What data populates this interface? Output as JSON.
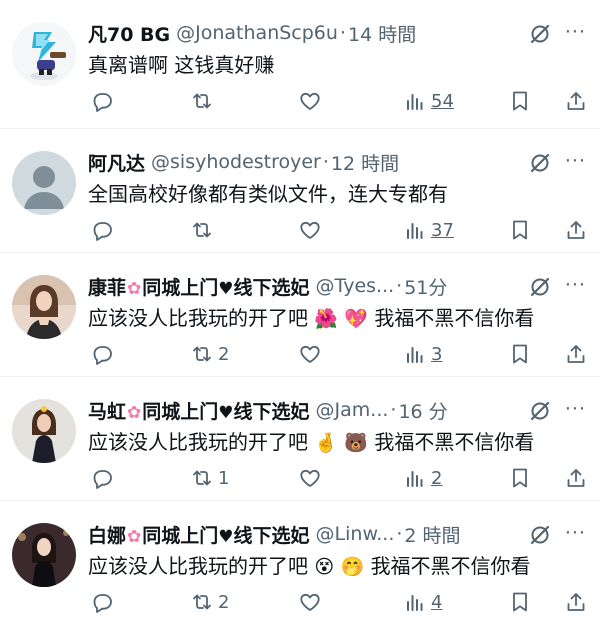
{
  "tweets": [
    {
      "name": "凡70 BG",
      "handle": "@JonathanScp6u",
      "time": "14 時間",
      "text": "真离谱啊 这钱真好赚",
      "emoji": [],
      "text_tail": "",
      "replies": "",
      "retweets": "",
      "likes": "",
      "views": "54",
      "avatar": "cartoon-character"
    },
    {
      "name": "阿凡达",
      "handle": "@sisyhodestroyer",
      "time": "12 時間",
      "text": "全国高校好像都有类似文件，连大专都有",
      "emoji": [],
      "text_tail": "",
      "replies": "",
      "retweets": "",
      "likes": "",
      "views": "37",
      "avatar": "default-profile"
    },
    {
      "name_a": "康菲",
      "name_b": "同城上门",
      "name_c": "线下选妃",
      "handle": "@Tyes...",
      "time": "51分",
      "text": "应该没人比我玩的开了吧",
      "emoji": [
        "🌺",
        "💖"
      ],
      "text_tail": "我福不黑不信你看",
      "replies": "",
      "retweets": "2",
      "likes": "",
      "views": "3",
      "avatar": "woman-photo"
    },
    {
      "name_a": "马虹",
      "name_b": "同城上门",
      "name_c": "线下选妃",
      "handle": "@Jam...",
      "time": "16 分",
      "text": "应该没人比我玩的开了吧",
      "emoji": [
        "🤞",
        "🐻"
      ],
      "text_tail": "我福不黑不信你看",
      "replies": "",
      "retweets": "1",
      "likes": "",
      "views": "2",
      "avatar": "woman-photo"
    },
    {
      "name_a": "白娜",
      "name_b": "同城上门",
      "name_c": "线下选妃",
      "handle": "@Linw...",
      "time": "2 時間",
      "text": "应该没人比我玩的开了吧",
      "emoji": [
        "😵",
        "🤭"
      ],
      "text_tail": "我福不黑不信你看",
      "replies": "",
      "retweets": "2",
      "likes": "",
      "views": "4",
      "avatar": "woman-photo"
    }
  ],
  "icons": {
    "flower": "✿",
    "heart": "♥",
    "more": "···"
  },
  "colors": {
    "text": "#0f1419",
    "secondary": "#536471",
    "divider": "#eff3f4",
    "flower": "#f07fb0"
  }
}
